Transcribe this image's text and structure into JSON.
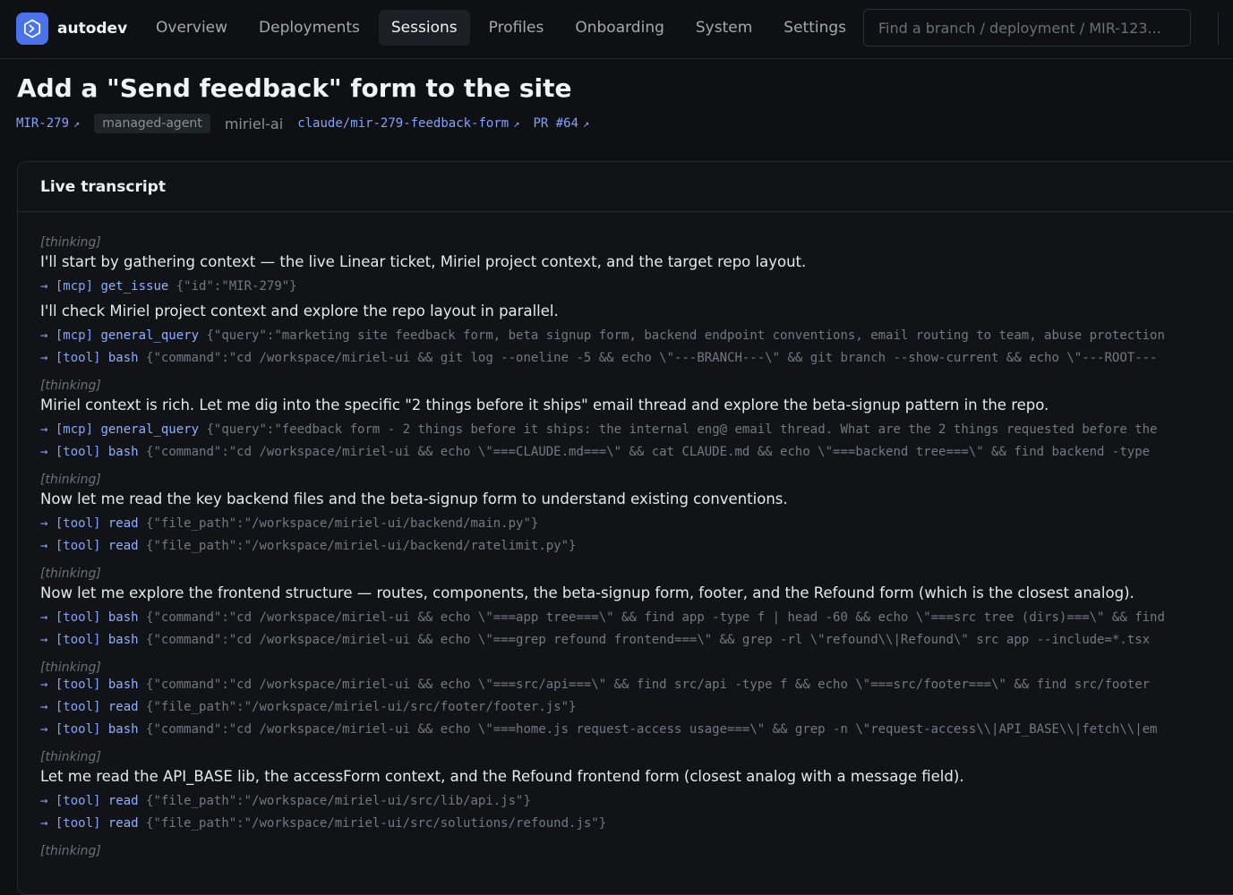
{
  "app": {
    "name": "autodev"
  },
  "nav": {
    "items": [
      {
        "label": "Overview"
      },
      {
        "label": "Deployments"
      },
      {
        "label": "Sessions",
        "active": true
      },
      {
        "label": "Profiles"
      },
      {
        "label": "Onboarding"
      },
      {
        "label": "System"
      },
      {
        "label": "Settings"
      }
    ]
  },
  "search": {
    "placeholder": "Find a branch / deployment / MIR-123..."
  },
  "session": {
    "title": "Add a \"Send feedback\" form to the site",
    "ticket": "MIR-279",
    "tag": "managed-agent",
    "org": "miriel-ai",
    "branch": "claude/mir-279-feedback-form",
    "pr": "PR #64",
    "external_arrow": "↗"
  },
  "transcript": {
    "title": "Live transcript",
    "entries": [
      {
        "type": "thinking",
        "text": "[thinking]"
      },
      {
        "type": "text",
        "text": "I'll start by gathering context — the live Linear ticket, Miriel project context, and the target repo layout."
      },
      {
        "type": "call",
        "kind": "[mcp]",
        "name": "get_issue",
        "args": "{\"id\":\"MIR-279\"}"
      },
      {
        "type": "text",
        "text": "I'll check Miriel project context and explore the repo layout in parallel."
      },
      {
        "type": "call",
        "kind": "[mcp]",
        "name": "general_query",
        "args": "{\"query\":\"marketing site feedback form, beta signup form, backend endpoint conventions, email routing to team, abuse protection"
      },
      {
        "type": "call",
        "kind": "[tool]",
        "name": "bash",
        "args": "{\"command\":\"cd /workspace/miriel-ui && git log --oneline -5 && echo \\\"---BRANCH---\\\" && git branch --show-current && echo \\\"---ROOT---"
      },
      {
        "type": "thinking",
        "text": "[thinking]"
      },
      {
        "type": "text",
        "text": "Miriel context is rich. Let me dig into the specific \"2 things before it ships\" email thread and explore the beta-signup pattern in the repo."
      },
      {
        "type": "call",
        "kind": "[mcp]",
        "name": "general_query",
        "args": "{\"query\":\"feedback form - 2 things before it ships: the internal eng@ email thread. What are the 2 things requested before the"
      },
      {
        "type": "call",
        "kind": "[tool]",
        "name": "bash",
        "args": "{\"command\":\"cd /workspace/miriel-ui && echo \\\"===CLAUDE.md===\\\" && cat CLAUDE.md && echo \\\"===backend tree===\\\" && find backend -type"
      },
      {
        "type": "thinking",
        "text": "[thinking]"
      },
      {
        "type": "text",
        "text": "Now let me read the key backend files and the beta-signup form to understand existing conventions."
      },
      {
        "type": "call",
        "kind": "[tool]",
        "name": "read",
        "args": "{\"file_path\":\"/workspace/miriel-ui/backend/main.py\"}"
      },
      {
        "type": "call",
        "kind": "[tool]",
        "name": "read",
        "args": "{\"file_path\":\"/workspace/miriel-ui/backend/ratelimit.py\"}"
      },
      {
        "type": "thinking",
        "text": "[thinking]"
      },
      {
        "type": "text",
        "text": "Now let me explore the frontend structure — routes, components, the beta-signup form, footer, and the Refound form (which is the closest analog)."
      },
      {
        "type": "call",
        "kind": "[tool]",
        "name": "bash",
        "args": "{\"command\":\"cd /workspace/miriel-ui && echo \\\"===app tree===\\\" && find app -type f | head -60 && echo \\\"===src tree (dirs)===\\\" && find"
      },
      {
        "type": "call",
        "kind": "[tool]",
        "name": "bash",
        "args": "{\"command\":\"cd /workspace/miriel-ui && echo \\\"===grep refound frontend===\\\" && grep -rl \\\"refound\\\\|Refound\\\" src app --include=*.tsx"
      },
      {
        "type": "thinking",
        "text": "[thinking]"
      },
      {
        "type": "call",
        "kind": "[tool]",
        "name": "bash",
        "args": "{\"command\":\"cd /workspace/miriel-ui && echo \\\"===src/api===\\\" && find src/api -type f && echo \\\"===src/footer===\\\" && find src/footer"
      },
      {
        "type": "call",
        "kind": "[tool]",
        "name": "read",
        "args": "{\"file_path\":\"/workspace/miriel-ui/src/footer/footer.js\"}"
      },
      {
        "type": "call",
        "kind": "[tool]",
        "name": "bash",
        "args": "{\"command\":\"cd /workspace/miriel-ui && echo \\\"===home.js request-access usage===\\\" && grep -n \\\"request-access\\\\|API_BASE\\\\|fetch\\\\|em"
      },
      {
        "type": "thinking",
        "text": "[thinking]"
      },
      {
        "type": "text",
        "text": "Let me read the API_BASE lib, the accessForm context, and the Refound frontend form (closest analog with a message field)."
      },
      {
        "type": "call",
        "kind": "[tool]",
        "name": "read",
        "args": "{\"file_path\":\"/workspace/miriel-ui/src/lib/api.js\"}"
      },
      {
        "type": "call",
        "kind": "[tool]",
        "name": "read",
        "args": "{\"file_path\":\"/workspace/miriel-ui/src/solutions/refound.js\"}"
      },
      {
        "type": "thinking",
        "text": "[thinking]"
      }
    ]
  }
}
